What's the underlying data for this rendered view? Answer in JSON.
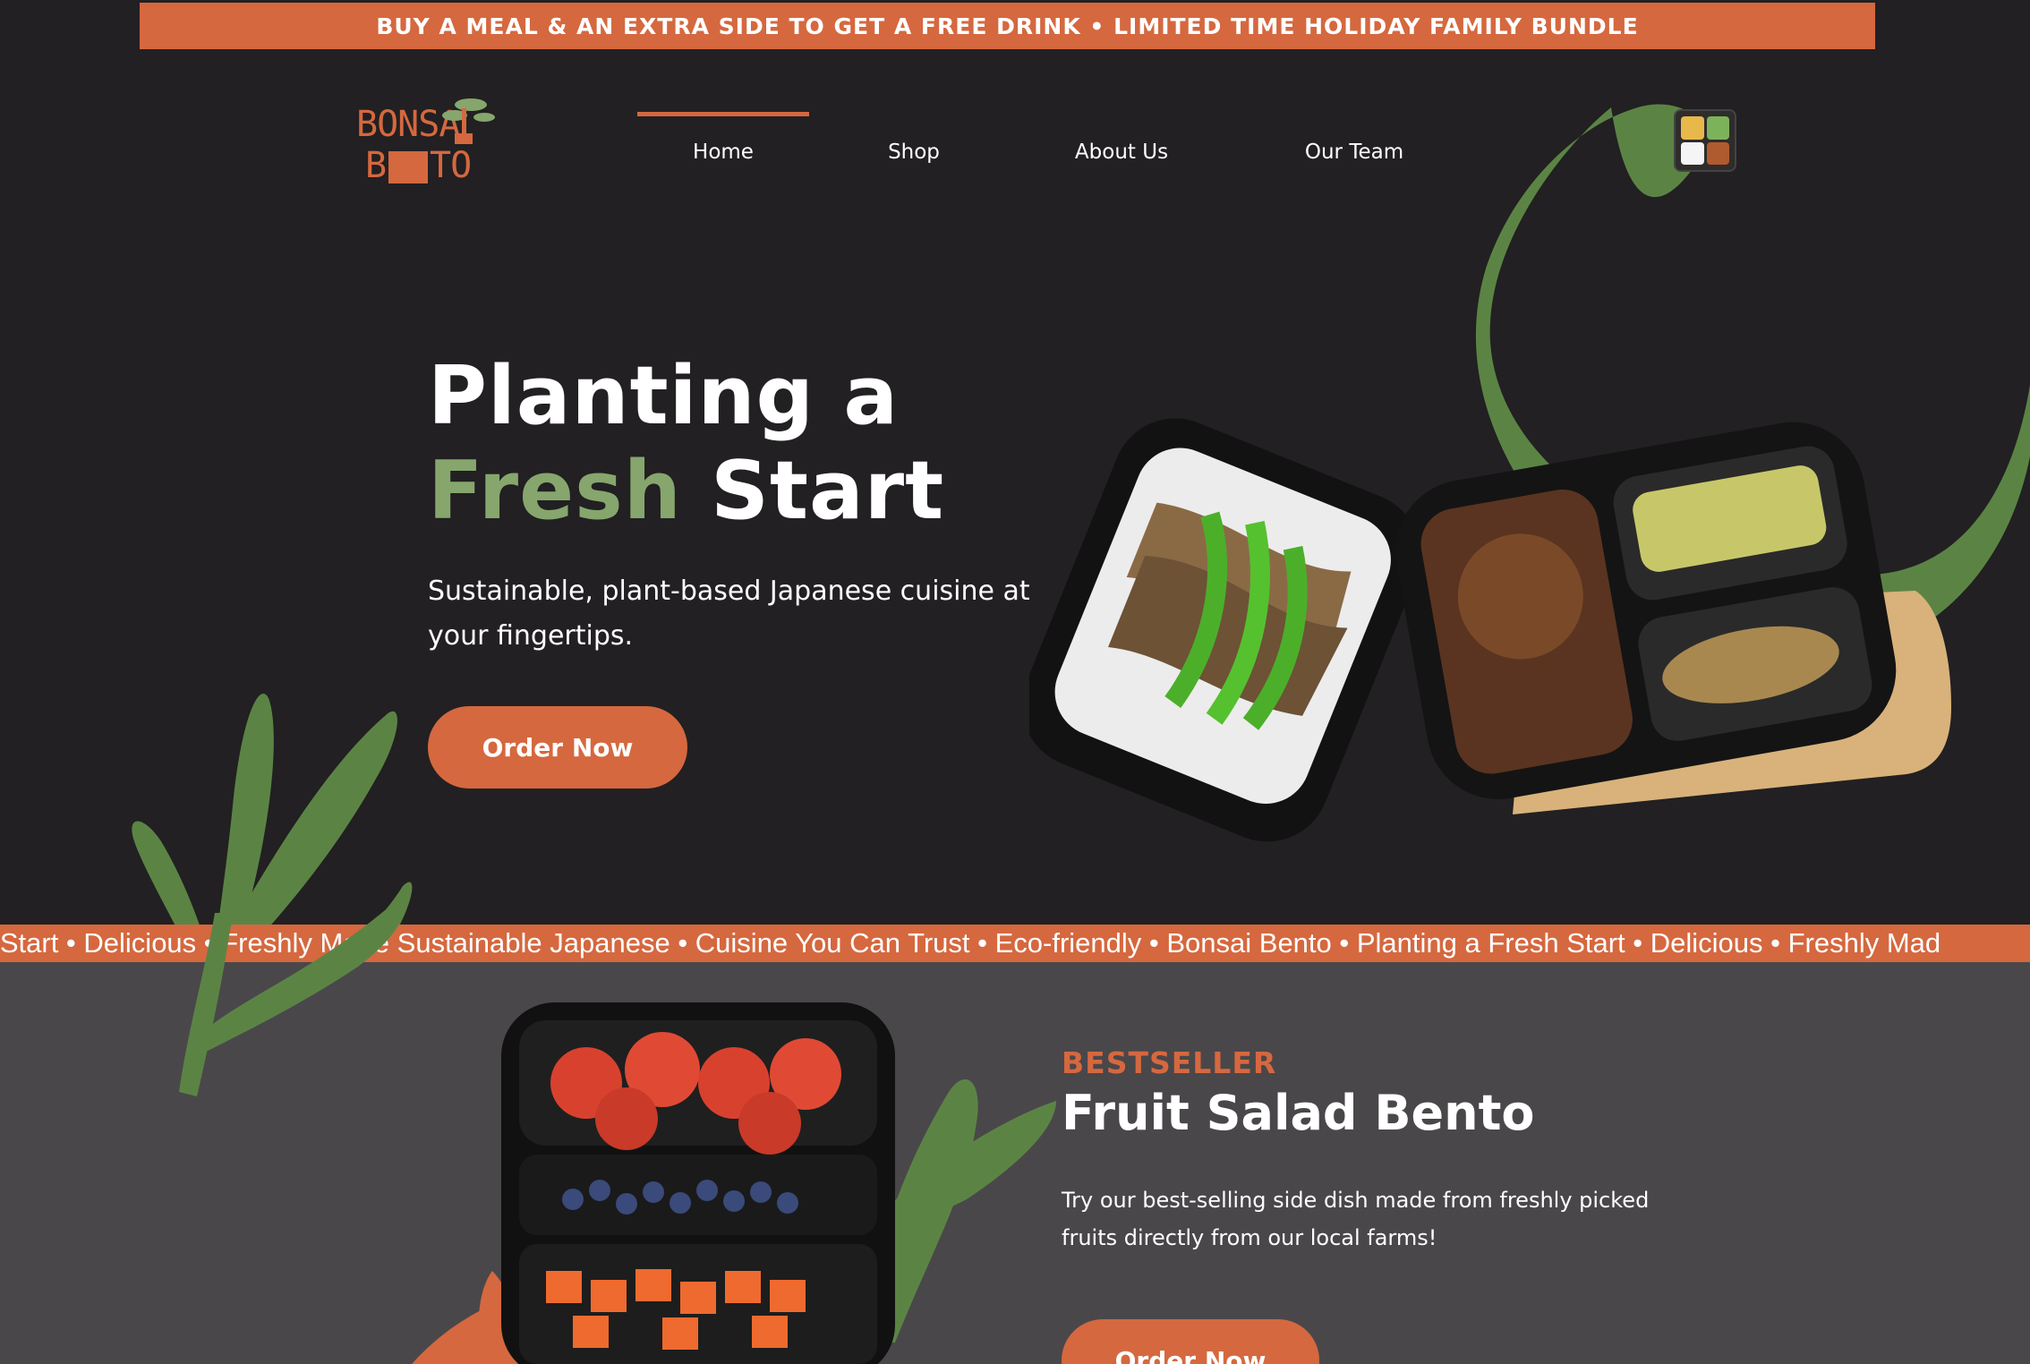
{
  "announcement": "BUY A MEAL & AN EXTRA SIDE TO GET A FREE DRINK • LIMITED TIME HOLIDAY FAMILY BUNDLE",
  "logo": {
    "line1": "BONSA",
    "line2": "B",
    "line3": "TO"
  },
  "nav": [
    {
      "label": "Home",
      "active": true
    },
    {
      "label": "Shop"
    },
    {
      "label": "About Us"
    },
    {
      "label": "Our Team"
    }
  ],
  "hero": {
    "title_line1": "Planting a",
    "title_accent": "Fresh",
    "title_rest": "Start",
    "subtitle": "Sustainable, plant-based Japanese cuisine at your fingertips.",
    "cta": "Order Now"
  },
  "ticker": "h Start • Delicious • Freshly Made Sustainable Japanese • Cuisine You Can Trust • Eco-friendly • Bonsai Bento • Planting a Fresh Start • Delicious • Freshly Mad",
  "product": {
    "eyebrow": "BESTSELLER",
    "title": "Fruit Salad Bento",
    "description": "Try our best-selling side dish made from freshly picked fruits directly from our local farms!",
    "cta": "Order Now"
  },
  "colors": {
    "accent": "#d5683f",
    "green": "#5b8444",
    "bg_dark": "#222022",
    "bg_section": "#4a474a"
  }
}
